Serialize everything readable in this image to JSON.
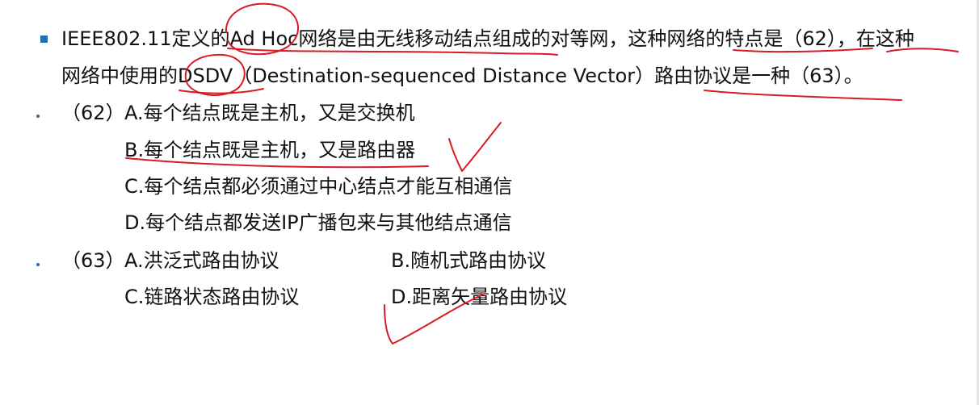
{
  "question": {
    "stem_line1": "IEEE802.11定义的Ad Hoc网络是由无线移动结点组成的对等网，这种网络的特点是（62），在这种",
    "stem_line2": "网络中使用的DSDV（Destination-sequenced Distance Vector）路由协议是一种（63）。"
  },
  "q62": {
    "number": "（62）",
    "option_a": "A.每个结点既是主机，又是交换机",
    "option_b": "B.每个结点既是主机，又是路由器",
    "option_c": "C.每个结点都必须通过中心结点才能互相通信",
    "option_d": "D.每个结点都发送IP广播包来与其他结点通信"
  },
  "q63": {
    "number": "（63）",
    "option_a": "A.洪泛式路由协议",
    "option_b": "B.随机式路由协议",
    "option_c": "C.链路状态路由协议",
    "option_d": "D.距离矢量路由协议"
  },
  "colors": {
    "text": "#111111",
    "bullet": "#1f6fb4",
    "annotation_ink": "#d81b25",
    "background": "#ffffff"
  }
}
